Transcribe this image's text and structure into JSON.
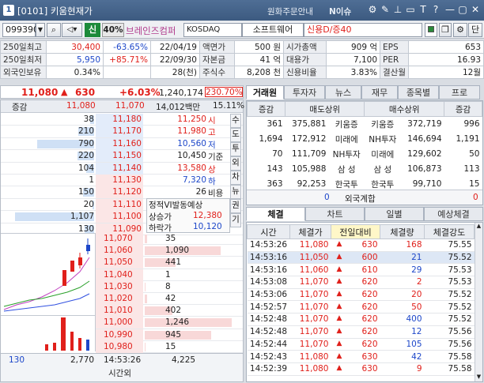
{
  "titlebar": {
    "num": "1",
    "title": "[0101] 키움현재가",
    "link1": "원화주문안내",
    "link2": "N이슈",
    "icons": [
      "gear-icon",
      "pin-icon",
      "lock-icon",
      "tablet-icon",
      "text-icon",
      "help-icon",
      "minimize-icon",
      "restore-icon",
      "close-icon"
    ],
    "icon_glyphs": [
      "⚙",
      "✎",
      "⊥",
      "▭",
      "T",
      "?",
      "—",
      "▢",
      "✕"
    ]
  },
  "toolbar": {
    "code": "099390",
    "badge": "신",
    "pct": "40%",
    "name": "브레인즈컴퍼",
    "market": "KOSDAQ",
    "sector": "소프트웨어",
    "credit": "신용D/증40",
    "btn_dan": "단"
  },
  "info": {
    "rows": [
      [
        "250일최고",
        "30,400",
        "-63.65%",
        "22/04/19",
        "액면가",
        "500 원",
        "시가총액",
        "909 억",
        "EPS",
        "653"
      ],
      [
        "250일최저",
        "5,950",
        "+85.71%",
        "22/09/30",
        "자본금",
        "41 억",
        "대용가",
        "7,100",
        "PER",
        "16.93"
      ],
      [
        "외국인보유",
        "0.34%",
        "",
        "28(천)",
        "주식수",
        "8,208 천",
        "신용비율",
        "3.83%",
        "결산월",
        "12월"
      ]
    ]
  },
  "price": {
    "current": "11,080",
    "arrow": "▲",
    "change": "630",
    "rate": "+6.03%",
    "volume": "1,240,174",
    "vol_rate": "230.70%"
  },
  "orderbook": {
    "header": [
      "증감",
      "11,080",
      "11,070",
      "14,012백만",
      "15.11%"
    ],
    "asks": [
      {
        "qty": "38",
        "price": "11,180",
        "bar": 0.05
      },
      {
        "qty": "210",
        "price": "11,170",
        "bar": 0.2
      },
      {
        "qty": "790",
        "price": "11,160",
        "bar": 0.72
      },
      {
        "qty": "220",
        "price": "11,150",
        "bar": 0.21
      },
      {
        "qty": "104",
        "price": "11,140",
        "bar": 0.1
      }
    ],
    "bids": [
      {
        "qty": "1",
        "price": "11,130",
        "bar": 0
      },
      {
        "qty": "150",
        "price": "11,120",
        "bar": 0.14
      },
      {
        "qty": "20",
        "price": "11,110",
        "bar": 0.02
      },
      {
        "qty": "1,107",
        "price": "11,100",
        "bar": 1.0
      },
      {
        "qty": "130",
        "price": "11,090",
        "bar": 0.12
      }
    ],
    "stats": [
      {
        "v": "11,250",
        "l": "시",
        "c": "red"
      },
      {
        "v": "11,980",
        "l": "고",
        "c": "red"
      },
      {
        "v": "10,560",
        "l": "저",
        "c": "blue"
      },
      {
        "v": "10,450",
        "l": "기준",
        "c": ""
      },
      {
        "v": "13,580",
        "l": "상",
        "c": "red"
      },
      {
        "v": "7,320",
        "l": "하",
        "c": "blue"
      },
      {
        "v": "26",
        "l": "비용",
        "c": ""
      }
    ],
    "vi": {
      "title": "정적VI발동예상",
      "up_l": "상승가",
      "up_v": "12,380",
      "dn_l": "하락가",
      "dn_v": "10,120"
    },
    "vtabs": [
      "수",
      "도",
      "투",
      "외",
      "차",
      "뉴",
      "권",
      "기"
    ],
    "lower": [
      {
        "price": "11,070",
        "qty": "35",
        "bar": 0.03
      },
      {
        "price": "11,060",
        "qty": "1,090",
        "bar": 0.87
      },
      {
        "price": "11,050",
        "qty": "441",
        "bar": 0.35
      },
      {
        "price": "11,040",
        "qty": "1",
        "bar": 0
      },
      {
        "price": "11,030",
        "qty": "8",
        "bar": 0.01
      },
      {
        "price": "11,020",
        "qty": "42",
        "bar": 0.03
      },
      {
        "price": "11,010",
        "qty": "402",
        "bar": 0.32
      },
      {
        "price": "11,000",
        "qty": "1,246",
        "bar": 1.0
      },
      {
        "price": "10,990",
        "qty": "945",
        "bar": 0.76
      },
      {
        "price": "10,980",
        "qty": "15",
        "bar": 0.01
      }
    ],
    "footer": [
      "130",
      "2,770",
      "14:53:26",
      "4,225"
    ],
    "footer_sub": "시간외"
  },
  "broker": {
    "tabs": [
      "거래원",
      "투자자",
      "뉴스",
      "재무",
      "종목별",
      "프로"
    ],
    "header": [
      "증감",
      "매도상위",
      "매수상위",
      "증감"
    ],
    "rows": [
      [
        "361",
        "375,881",
        "키움증",
        "키움증",
        "372,719",
        "996"
      ],
      [
        "1,694",
        "172,912",
        "미래에",
        "NH투자",
        "146,694",
        "1,191"
      ],
      [
        "70",
        "111,709",
        "NH투자",
        "미래에",
        "129,602",
        "50"
      ],
      [
        "143",
        "105,988",
        "삼 성",
        "삼 성",
        "106,873",
        "113"
      ],
      [
        "363",
        "92,253",
        "한국투",
        "한국투",
        "99,710",
        "15"
      ]
    ],
    "foreign": [
      "0",
      "외국계합",
      "0"
    ]
  },
  "ticks": {
    "tabs": [
      "체결",
      "차트",
      "일별",
      "예상체결"
    ],
    "header": [
      "시간",
      "체결가",
      "전일대비",
      "체결량",
      "체결강도"
    ],
    "rows": [
      [
        "14:53:26",
        "11,080",
        "630",
        "168",
        "75.55",
        "red"
      ],
      [
        "14:53:16",
        "11,050",
        "600",
        "21",
        "75.52",
        "blue"
      ],
      [
        "14:53:16",
        "11,060",
        "610",
        "29",
        "75.53",
        "blue"
      ],
      [
        "14:53:08",
        "11,070",
        "620",
        "2",
        "75.53",
        "red"
      ],
      [
        "14:53:06",
        "11,070",
        "620",
        "20",
        "75.52",
        "red"
      ],
      [
        "14:52:57",
        "11,070",
        "620",
        "50",
        "75.52",
        "red"
      ],
      [
        "14:52:48",
        "11,070",
        "620",
        "400",
        "75.52",
        "blue"
      ],
      [
        "14:52:48",
        "11,070",
        "620",
        "12",
        "75.56",
        "blue"
      ],
      [
        "14:52:44",
        "11,070",
        "620",
        "105",
        "75.56",
        "blue"
      ],
      [
        "14:52:43",
        "11,080",
        "630",
        "42",
        "75.58",
        "blue"
      ],
      [
        "14:52:39",
        "11,080",
        "630",
        "9",
        "75.58",
        "red"
      ]
    ]
  }
}
